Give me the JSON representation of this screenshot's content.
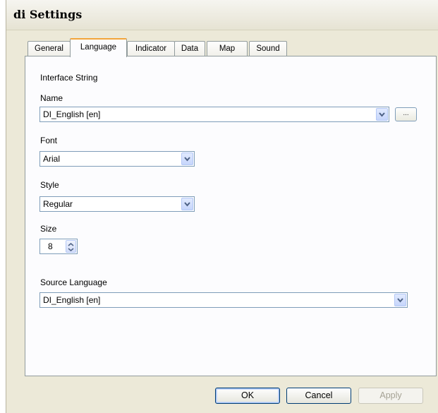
{
  "window": {
    "title": "di Settings"
  },
  "tabs": [
    {
      "label": "General",
      "active": false
    },
    {
      "label": "Language",
      "active": true
    },
    {
      "label": "Indicator",
      "active": false
    },
    {
      "label": "Data",
      "active": false
    },
    {
      "label": "Map",
      "active": false
    },
    {
      "label": "Sound",
      "active": false
    }
  ],
  "language": {
    "section_title": "Interface String",
    "name_label": "Name",
    "name_value": "DI_English [en]",
    "browse_label": "...",
    "font_label": "Font",
    "font_value": "Arial",
    "style_label": "Style",
    "style_value": "Regular",
    "size_label": "Size",
    "size_value": "8",
    "source_label": "Source Language",
    "source_value": "DI_English [en]"
  },
  "buttons": {
    "ok": "OK",
    "cancel": "Cancel",
    "apply": "Apply"
  },
  "icons": {
    "dropdown": "chevron-down-icon",
    "spin_up": "spin-up-icon",
    "spin_down": "spin-down-icon"
  }
}
